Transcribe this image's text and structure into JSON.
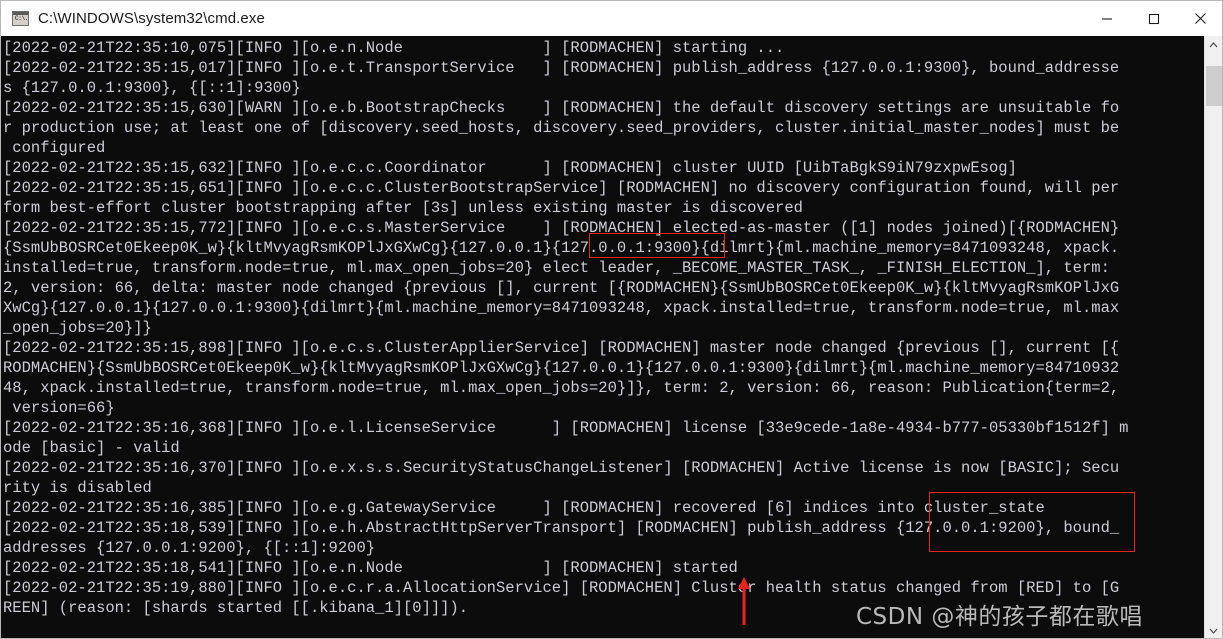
{
  "window": {
    "title": "C:\\WINDOWS\\system32\\cmd.exe",
    "icon": "cmd-icon",
    "icon_prompt": "C:\\.",
    "controls": {
      "minimize": "minimize-button",
      "maximize": "maximize-button",
      "close": "close-button"
    }
  },
  "console": {
    "background_color": "#0c0c0c",
    "text_color": "#ccccd4",
    "lines": [
      "[2022-02-21T22:35:10,075][INFO ][o.e.n.Node               ] [RODMACHEN] starting ...",
      "[2022-02-21T22:35:15,017][INFO ][o.e.t.TransportService   ] [RODMACHEN] publish_address {127.0.0.1:9300}, bound_addresse",
      "s {127.0.0.1:9300}, {[::1]:9300}",
      "[2022-02-21T22:35:15,630][WARN ][o.e.b.BootstrapChecks    ] [RODMACHEN] the default discovery settings are unsuitable fo",
      "r production use; at least one of [discovery.seed_hosts, discovery.seed_providers, cluster.initial_master_nodes] must be",
      " configured",
      "[2022-02-21T22:35:15,632][INFO ][o.e.c.c.Coordinator      ] [RODMACHEN] cluster UUID [UibTaBgkS9iN79zxpwEsog]",
      "[2022-02-21T22:35:15,651][INFO ][o.e.c.c.ClusterBootstrapService] [RODMACHEN] no discovery configuration found, will per",
      "form best-effort cluster bootstrapping after [3s] unless existing master is discovered",
      "[2022-02-21T22:35:15,772][INFO ][o.e.c.s.MasterService    ] [RODMACHEN] elected-as-master ([1] nodes joined)[{RODMACHEN}",
      "{SsmUbBOSRCet0Ekeep0K_w}{kltMvyagRsmKOPlJxGXwCg}{127.0.0.1}{127.0.0.1:9300}{dilmrt}{ml.machine_memory=8471093248, xpack.",
      "installed=true, transform.node=true, ml.max_open_jobs=20} elect leader, _BECOME_MASTER_TASK_, _FINISH_ELECTION_], term:",
      "2, version: 66, delta: master node changed {previous [], current [{RODMACHEN}{SsmUbBOSRCet0Ekeep0K_w}{kltMvyagRsmKOPlJxG",
      "XwCg}{127.0.0.1}{127.0.0.1:9300}{dilmrt}{ml.machine_memory=8471093248, xpack.installed=true, transform.node=true, ml.max",
      "_open_jobs=20}]}",
      "[2022-02-21T22:35:15,898][INFO ][o.e.c.s.ClusterApplierService] [RODMACHEN] master node changed {previous [], current [{",
      "RODMACHEN}{SsmUbBOSRCet0Ekeep0K_w}{kltMvyagRsmKOPlJxGXwCg}{127.0.0.1}{127.0.0.1:9300}{dilmrt}{ml.machine_memory=84710932",
      "48, xpack.installed=true, transform.node=true, ml.max_open_jobs=20}]}, term: 2, version: 66, reason: Publication{term=2,",
      " version=66}",
      "[2022-02-21T22:35:16,368][INFO ][o.e.l.LicenseService      ] [RODMACHEN] license [33e9cede-1a8e-4934-b777-05330bf1512f] m",
      "ode [basic] - valid",
      "[2022-02-21T22:35:16,370][INFO ][o.e.x.s.s.SecurityStatusChangeListener] [RODMACHEN] Active license is now [BASIC]; Secu",
      "rity is disabled",
      "[2022-02-21T22:35:16,385][INFO ][o.e.g.GatewayService     ] [RODMACHEN] recovered [6] indices into cluster_state",
      "[2022-02-21T22:35:18,539][INFO ][o.e.h.AbstractHttpServerTransport] [RODMACHEN] publish_address {127.0.0.1:9200}, bound_",
      "addresses {127.0.0.1:9200}, {[::1]:9200}",
      "[2022-02-21T22:35:18,541][INFO ][o.e.n.Node               ] [RODMACHEN] started",
      "[2022-02-21T22:35:19,880][INFO ][o.e.c.r.a.AllocationService] [RODMACHEN] Cluster health status changed from [RED] to [G",
      "REEN] (reason: [shards started [[.kibana_1][0]]])."
    ]
  },
  "scrollbar": {
    "up_arrow": "scroll-up-arrow",
    "down_arrow": "scroll-down-arrow",
    "thumb": "scrollbar-thumb"
  },
  "annotations": {
    "color": "#e8221c",
    "box_1_target": "{127.0.0.1:9300}",
    "box_2_target": "into cluster_state / {127.0.0.1:9200},",
    "arrow_target": "Cluster health status changed from [RED] to [GREEN]"
  },
  "watermark": {
    "text": "CSDN @神的孩子都在歌唱",
    "color": "#b9b9b9"
  }
}
